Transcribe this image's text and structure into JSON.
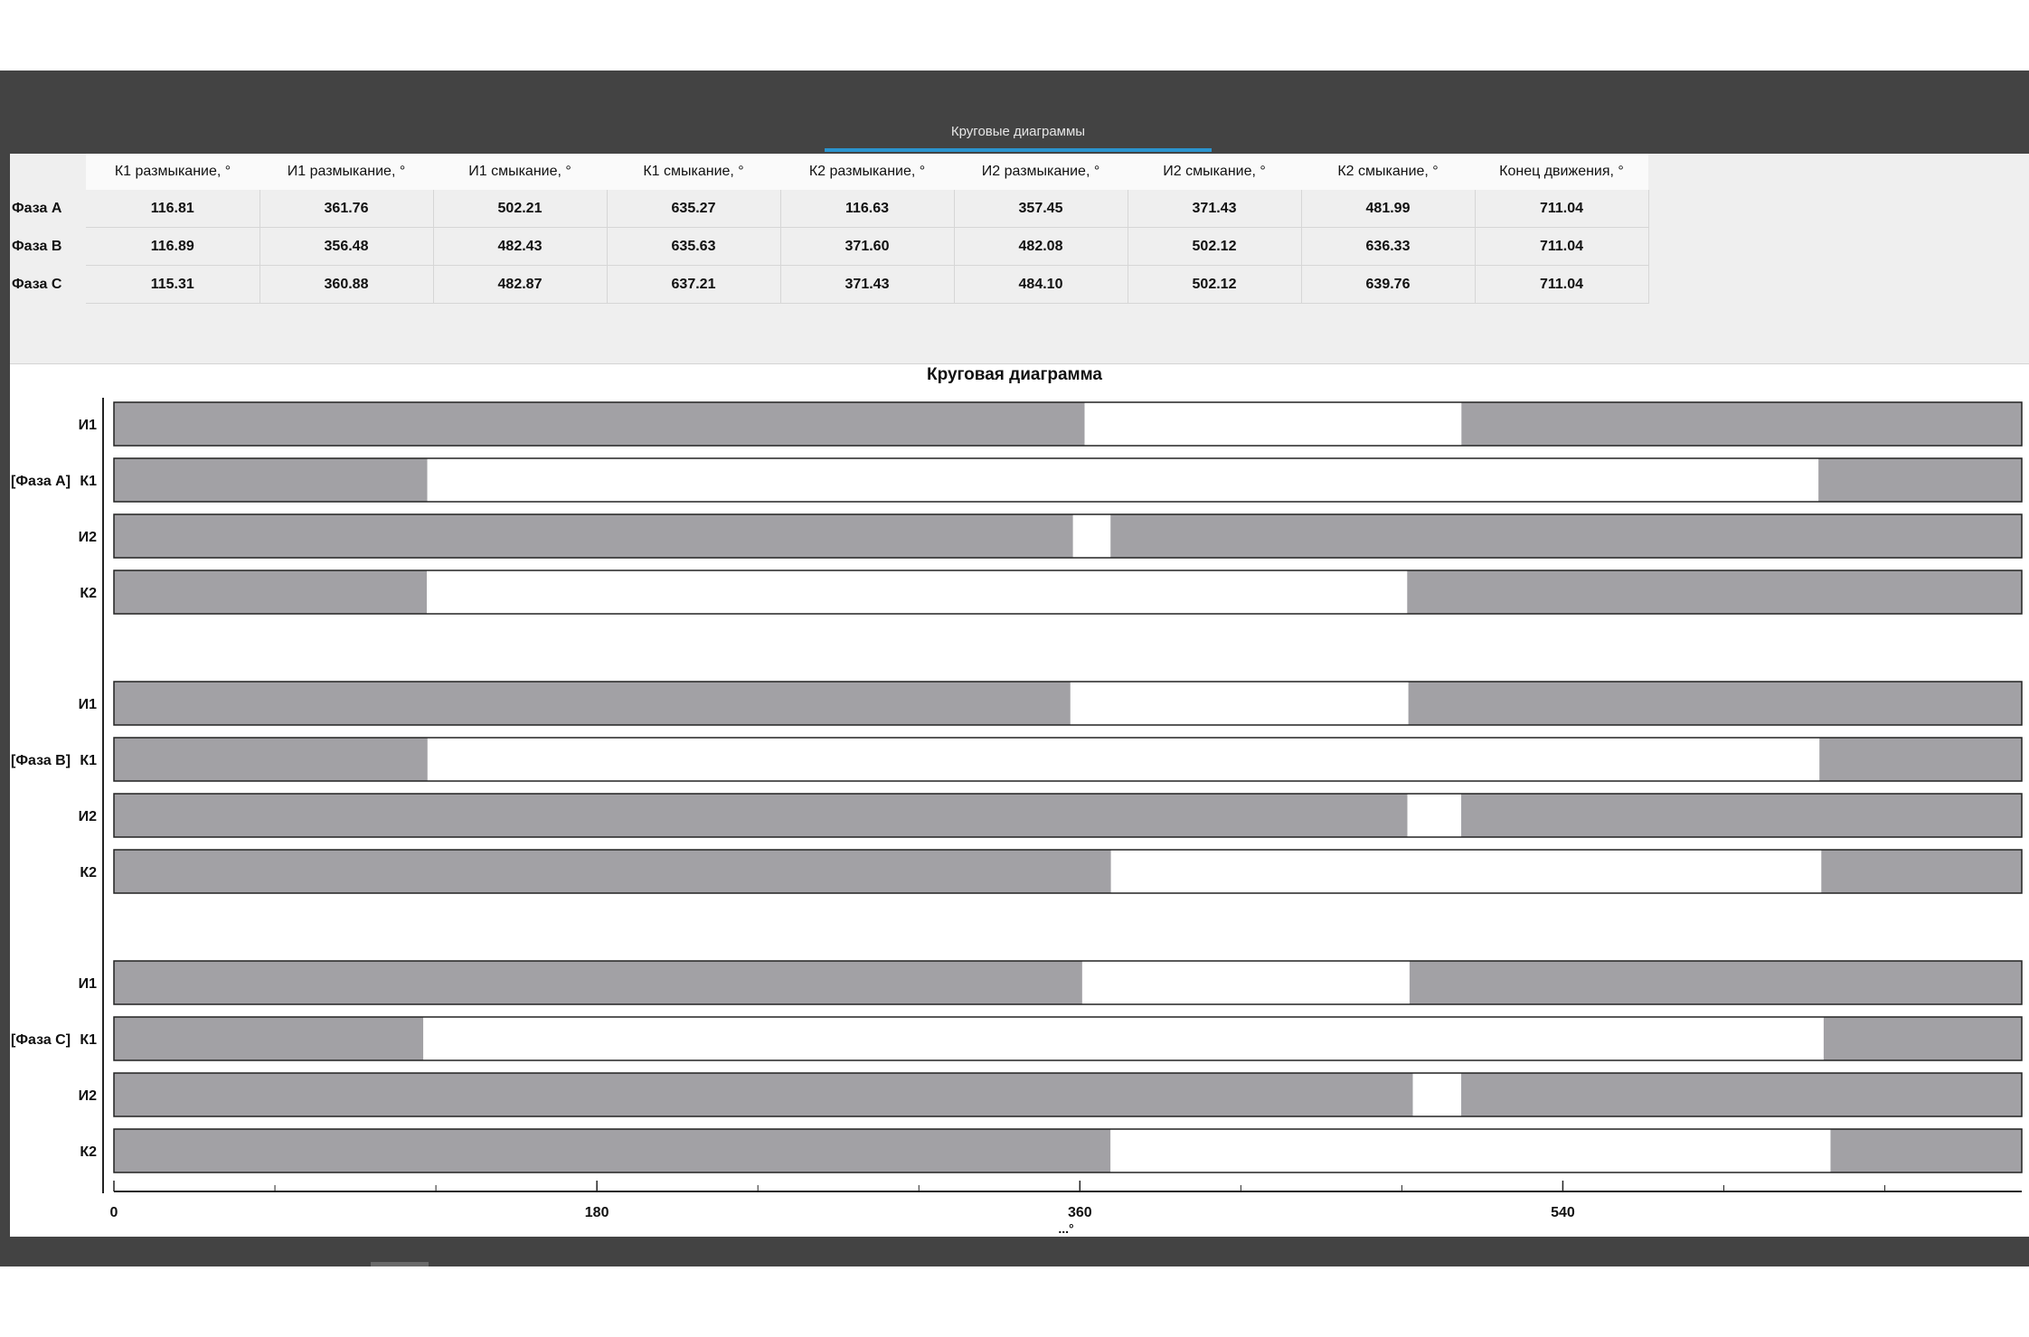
{
  "tab": {
    "label": "Круговые диаграммы"
  },
  "table": {
    "headers": [
      "К1 размыкание, °",
      "И1 размыкание, °",
      "И1 смыкание, °",
      "К1 смыкание, °",
      "К2 размыкание, °",
      "И2 размыкание, °",
      "И2 смыкание, °",
      "К2 смыкание, °",
      "Конец движения, °"
    ],
    "rows": [
      {
        "label": "Фаза А",
        "values": [
          "116.81",
          "361.76",
          "502.21",
          "635.27",
          "116.63",
          "357.45",
          "371.43",
          "481.99",
          "711.04"
        ]
      },
      {
        "label": "Фаза В",
        "values": [
          "116.89",
          "356.48",
          "482.43",
          "635.63",
          "371.60",
          "482.08",
          "502.12",
          "636.33",
          "711.04"
        ]
      },
      {
        "label": "Фаза С",
        "values": [
          "115.31",
          "360.88",
          "482.87",
          "637.21",
          "371.43",
          "484.10",
          "502.12",
          "639.76",
          "711.04"
        ]
      }
    ]
  },
  "chart_data": {
    "type": "bar",
    "title": "Круговая диаграмма",
    "xlabel": "...°",
    "xlim": [
      0,
      711.04
    ],
    "xticks": [
      0,
      180,
      360,
      540
    ],
    "minor_tick_step": 60,
    "colors": {
      "closed": "#a2a1a5",
      "open": "#ffffff",
      "border": "#222222"
    },
    "groups": [
      {
        "label": "[Фаза А]",
        "rows": [
          {
            "label": "И1",
            "open_from": 361.76,
            "open_to": 502.21
          },
          {
            "label": "К1",
            "open_from": 116.81,
            "open_to": 635.27
          },
          {
            "label": "И2",
            "open_from": 357.45,
            "open_to": 371.43
          },
          {
            "label": "К2",
            "open_from": 116.63,
            "open_to": 481.99
          }
        ]
      },
      {
        "label": "[Фаза В]",
        "rows": [
          {
            "label": "И1",
            "open_from": 356.48,
            "open_to": 482.43
          },
          {
            "label": "К1",
            "open_from": 116.89,
            "open_to": 635.63
          },
          {
            "label": "И2",
            "open_from": 482.08,
            "open_to": 502.12
          },
          {
            "label": "К2",
            "open_from": 371.6,
            "open_to": 636.33
          }
        ]
      },
      {
        "label": "[Фаза С]",
        "rows": [
          {
            "label": "И1",
            "open_from": 360.88,
            "open_to": 482.87
          },
          {
            "label": "К1",
            "open_from": 115.31,
            "open_to": 637.21
          },
          {
            "label": "И2",
            "open_from": 484.1,
            "open_to": 502.12
          },
          {
            "label": "К2",
            "open_from": 371.43,
            "open_to": 639.76
          }
        ]
      }
    ]
  }
}
